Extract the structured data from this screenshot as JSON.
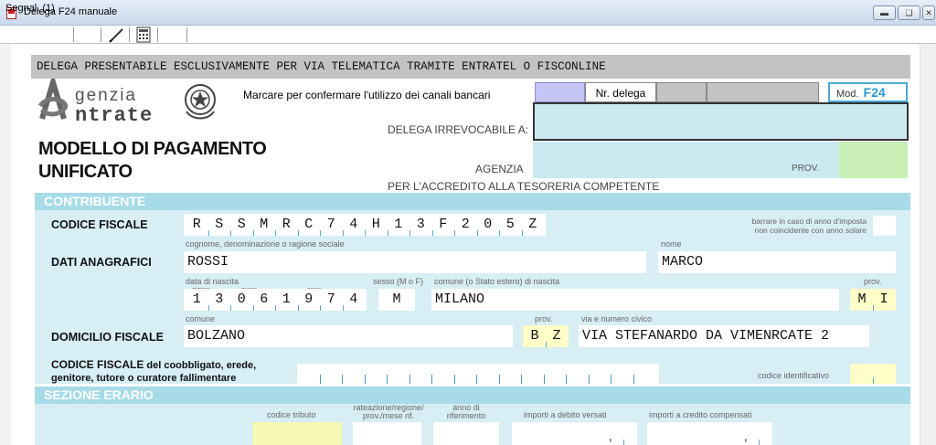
{
  "window": {
    "title": "Delega F24 manuale",
    "buttons": [
      "minimize",
      "restore",
      "close"
    ]
  },
  "menubar": {
    "segnal": "Segnal. (1)",
    "tools": [
      "pencil-icon",
      "calculator-icon"
    ]
  },
  "form": {
    "banner": "DELEGA PRESENTABILE ESCLUSIVAMENTE PER VIA TELEMATICA TRAMITE ENTRATEL O FISCONLINE",
    "logo": {
      "line1": "genzia",
      "line2": "ntrate"
    },
    "bank_channels_text": "Marcare per confermare l'utilizzo dei canali bancari",
    "nr_delega_label": "Nr. delega",
    "mod_label": "Mod.",
    "mod_code": "F24",
    "delega_label": "DELEGA IRREVOCABILE A:",
    "title_line1": "MODELLO DI PAGAMENTO",
    "title_line2": "UNIFICATO",
    "agenzia_label": "AGENZIA",
    "prov_label": "PROV.",
    "tesoreria_label": "PER L'ACCREDITO ALLA TESORERIA COMPETENTE"
  },
  "contribuente": {
    "section_title": "CONTRIBUENTE",
    "codice_fiscale_label": "CODICE FISCALE",
    "codice_fiscale_chars": [
      "R",
      "S",
      "S",
      "M",
      "R",
      "C",
      "7",
      "4",
      "H",
      "1",
      "3",
      "F",
      "2",
      "0",
      "5",
      "Z"
    ],
    "anno_note_line1": "barrare in caso di anno d'imposta",
    "anno_note_line2": "non coincidente con anno solare",
    "dati_anagrafici_label": "DATI ANAGRAFICI",
    "cognome_caption": "cognome, denominazione o ragione sociale",
    "cognome": "ROSSI",
    "nome_caption": "nome",
    "nome": "MARCO",
    "data_nascita_caption": "data di nascita",
    "giorno_caption": "giorno",
    "mese_caption": "mese",
    "anno_caption": "anno",
    "data_nascita_chars": [
      "1",
      "3",
      "0",
      "6",
      "1",
      "9",
      "7",
      "4"
    ],
    "sesso_caption": "sesso (M o F)",
    "sesso": "M",
    "comune_nascita_caption": "comune (o Stato estero) di nascita",
    "comune_nascita": "MILANO",
    "prov_caption": "prov.",
    "prov_nascita_chars": [
      "M",
      "I"
    ],
    "domicilio_label": "DOMICILIO FISCALE",
    "comune_caption": "comune",
    "comune": "BOLZANO",
    "prov_domicilio_chars": [
      "B",
      "Z"
    ],
    "via_caption": "via e numero civico",
    "via": "VIA STEFANARDO DA VIMENRCATE 2",
    "coobbligato_bold": "CODICE FISCALE",
    "coobbligato_rest": " del coobbligato, erede,",
    "coobbligato_line2": "genitore, tutore o curatore fallimentare",
    "codice_identificativo_caption": "codice identificativo"
  },
  "erario": {
    "section_title": "SEZIONE ERARIO",
    "codice_tributo_caption": "codice tributo",
    "rateazione_caption_line1": "rateazione/regione/",
    "rateazione_caption_line2": "prov./mese rif.",
    "anno_rif_caption_line1": "anno di",
    "anno_rif_caption_line2": "riferimento",
    "importi_debito_caption": "importi a debito versati",
    "importi_credito_caption": "importi a credito compensati"
  },
  "colors": {
    "section_bar": "#a7dbe8",
    "section_bg": "#d7eef5",
    "agenzia_box": "#cce9f2",
    "prov_box": "#c8eeb4",
    "bank_box": "#c5c5f5",
    "prov_field": "#fffdc8",
    "mod_accent": "#2a9ad2"
  }
}
